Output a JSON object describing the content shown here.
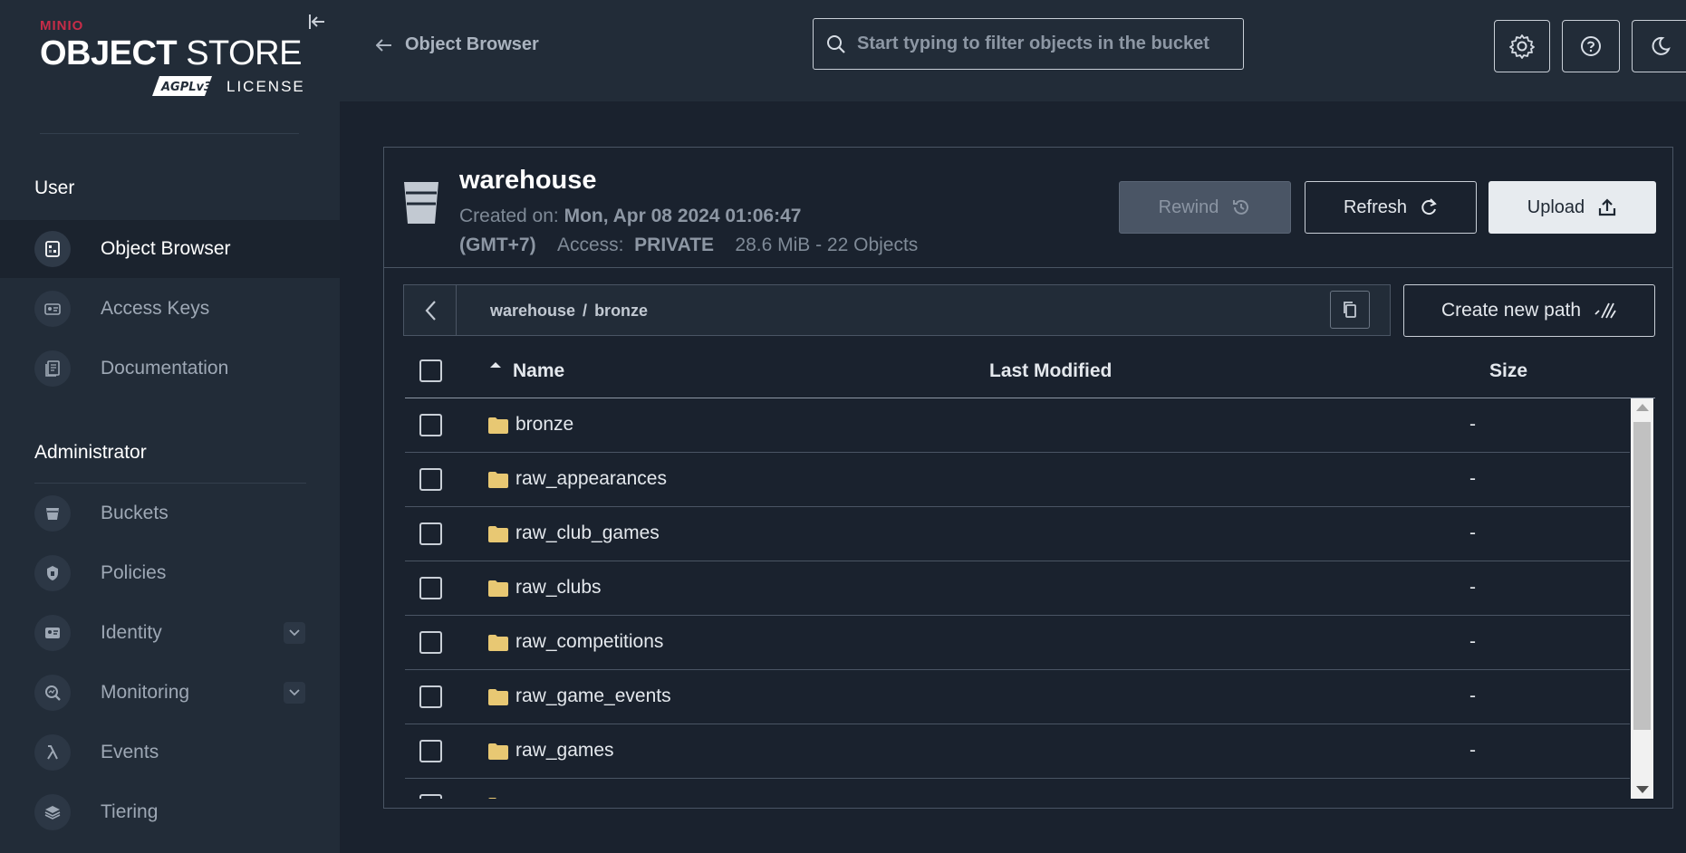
{
  "brand": {
    "minio": "MINIO",
    "object": "OBJECT",
    "store": " STORE",
    "agpl": "AGPLv3",
    "license": "LICENSE"
  },
  "sidebar": {
    "user_title": "User",
    "user_items": [
      {
        "label": "Object Browser",
        "icon": "object-browser-icon",
        "active": true
      },
      {
        "label": "Access Keys",
        "icon": "access-keys-icon"
      },
      {
        "label": "Documentation",
        "icon": "documentation-icon"
      }
    ],
    "admin_title": "Administrator",
    "admin_items": [
      {
        "label": "Buckets",
        "icon": "bucket-icon"
      },
      {
        "label": "Policies",
        "icon": "policy-icon"
      },
      {
        "label": "Identity",
        "icon": "identity-icon",
        "expandable": true
      },
      {
        "label": "Monitoring",
        "icon": "monitoring-icon",
        "expandable": true
      },
      {
        "label": "Events",
        "icon": "lambda-icon"
      },
      {
        "label": "Tiering",
        "icon": "tiering-icon"
      }
    ]
  },
  "header": {
    "back_label": "Object Browser",
    "search_placeholder": "Start typing to filter objects in the bucket",
    "buttons": [
      "settings-icon",
      "help-icon",
      "theme-toggle-icon"
    ]
  },
  "bucket": {
    "name": "warehouse",
    "created_label": "Created on:",
    "created_value": "Mon, Apr 08 2024 01:06:47",
    "timezone": "(GMT+7)",
    "access_label": "Access:",
    "access_value": "PRIVATE",
    "usage": "28.6 MiB - 22 Objects",
    "rewind_label": "Rewind",
    "refresh_label": "Refresh",
    "upload_label": "Upload"
  },
  "breadcrumb": {
    "parts": [
      "warehouse",
      "/",
      "bronze"
    ],
    "new_path_label": "Create new path"
  },
  "table": {
    "columns": {
      "name": "Name",
      "last_modified": "Last Modified",
      "size": "Size"
    },
    "rows": [
      {
        "name": "bronze",
        "last_modified": "",
        "size": "-"
      },
      {
        "name": "raw_appearances",
        "last_modified": "",
        "size": "-"
      },
      {
        "name": "raw_club_games",
        "last_modified": "",
        "size": "-"
      },
      {
        "name": "raw_clubs",
        "last_modified": "",
        "size": "-"
      },
      {
        "name": "raw_competitions",
        "last_modified": "",
        "size": "-"
      },
      {
        "name": "raw_game_events",
        "last_modified": "",
        "size": "-"
      },
      {
        "name": "raw_games",
        "last_modified": "",
        "size": "-"
      },
      {
        "name": "",
        "last_modified": "",
        "size": ""
      }
    ]
  },
  "colors": {
    "brand_red": "#c72c48",
    "folder": "#e8c873",
    "sidebar_bg": "#222c38",
    "main_bg": "#1a222e"
  }
}
